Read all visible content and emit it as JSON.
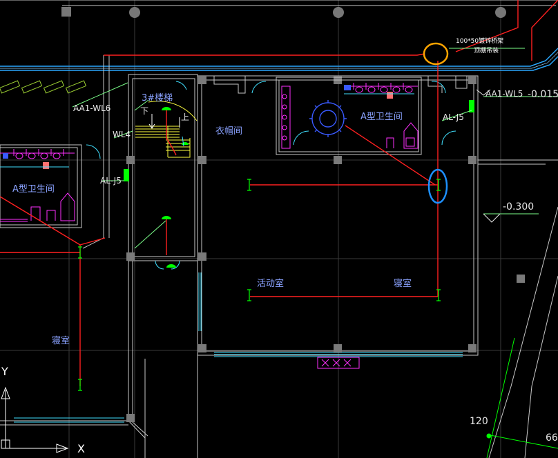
{
  "rooms": {
    "stair": "3#楼梯",
    "cloak": "衣帽间",
    "toilet_right": "A型卫生间",
    "toilet_left": "A型卫生间",
    "activity": "活动室",
    "bedroom_right": "寝室",
    "bedroom_left": "寝室"
  },
  "stair_marks": {
    "down": "下",
    "up": "上"
  },
  "tags": {
    "aa1_wl6": "AA1-WL6",
    "wl4": "WL4",
    "al_j5_left": "AL-J5",
    "al_j5_right": "AL-J5",
    "aa1_wl5": "AA1-WL5",
    "elev_top": "-0.015",
    "elev_right": "-0.300",
    "dim_120": "120",
    "dim_66": "66"
  },
  "note": {
    "line1": "100*50镀锌桥架",
    "line2": "顶棚吊装"
  },
  "axis": {
    "y": "Y",
    "x": "X"
  },
  "colors": {
    "background": "#000000",
    "wall": "#c8c8c8",
    "column": "#7a7a7a",
    "cable": "#ff2020",
    "tray": "#2aa8ff",
    "fixture": "#ff30ff",
    "window": "#40e0ff",
    "marker_green": "#00ff00",
    "highlight_orange": "#ffa500",
    "highlight_blue": "#1e90ff"
  }
}
